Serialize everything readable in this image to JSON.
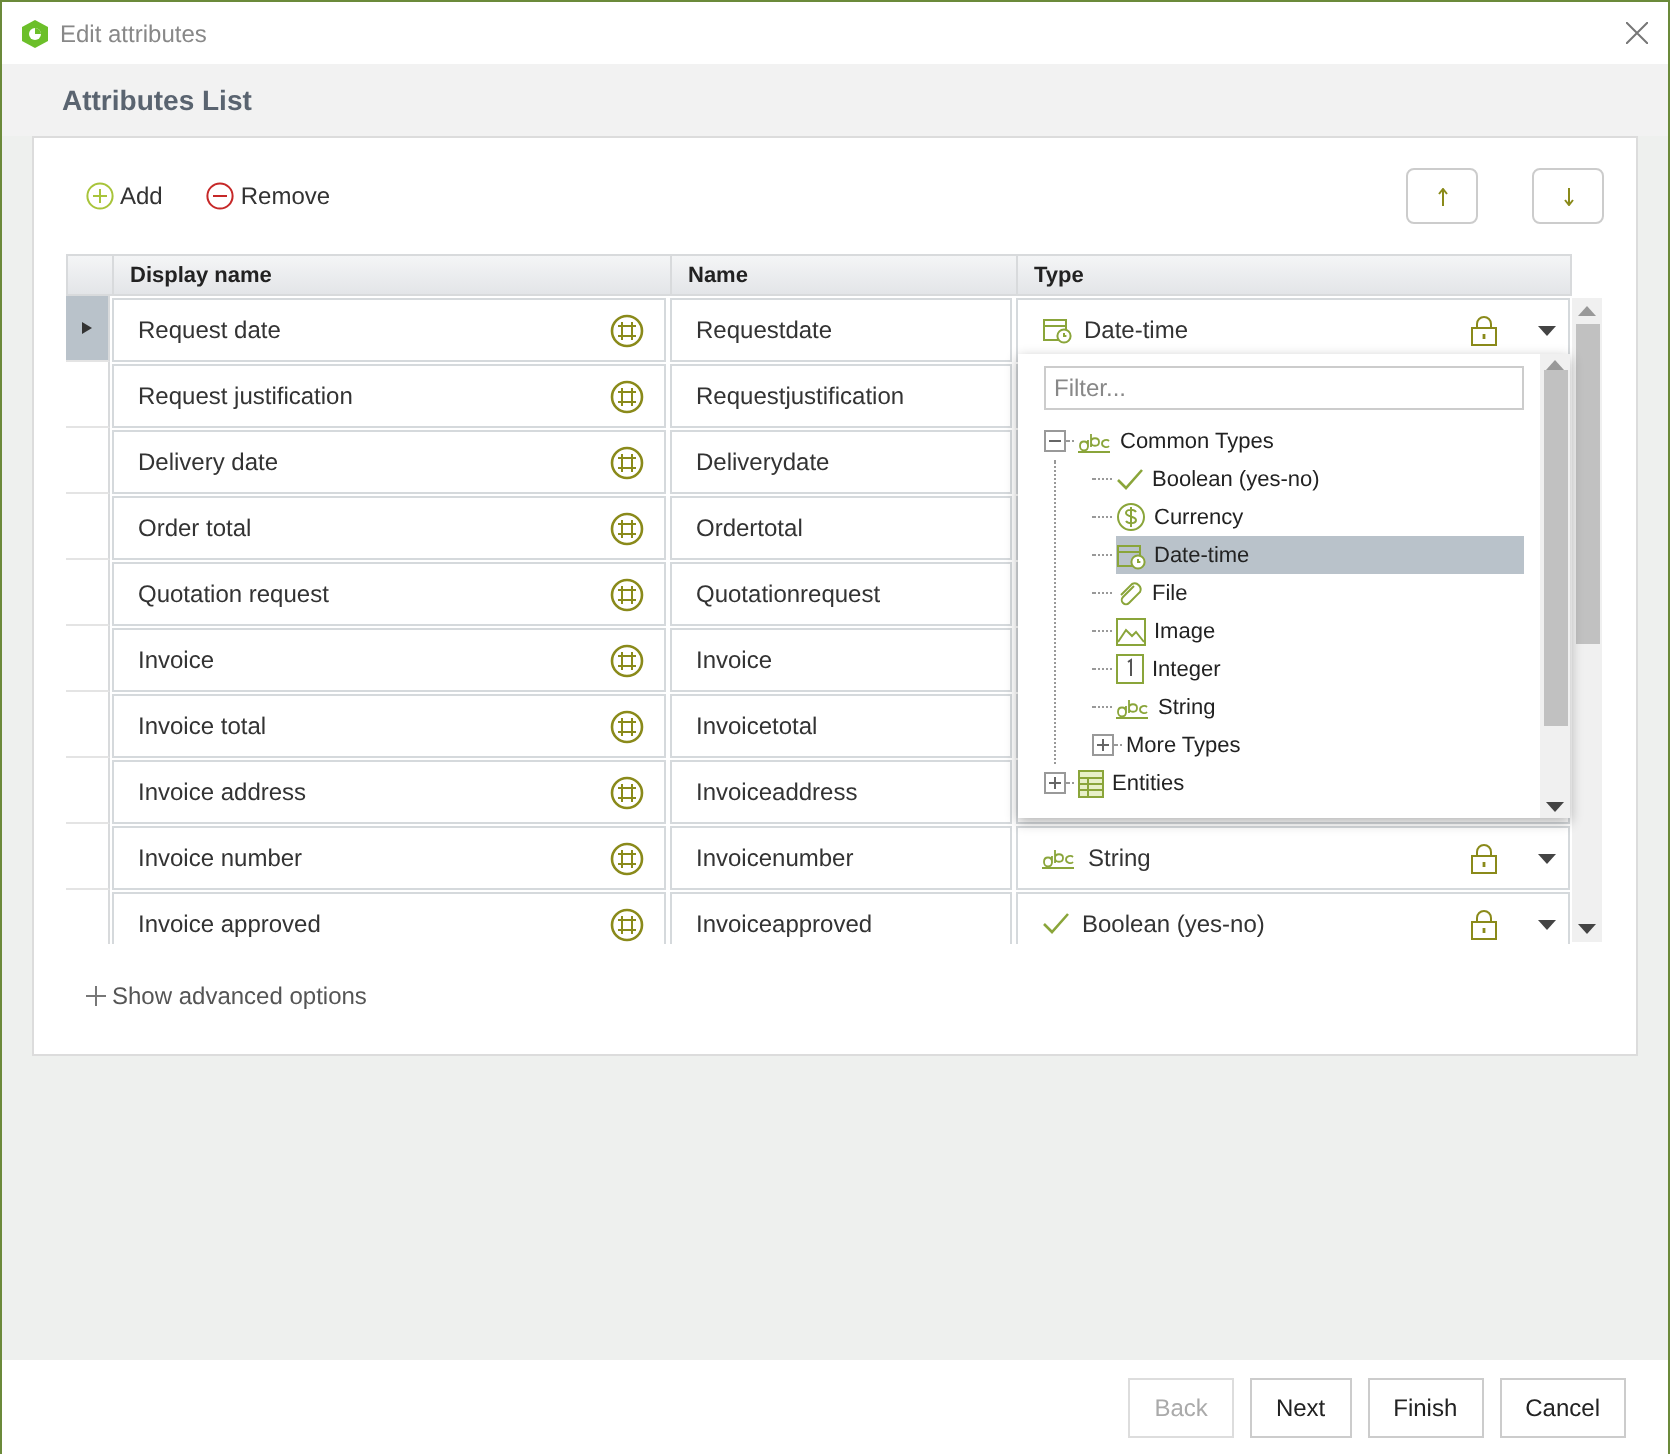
{
  "window": {
    "title": "Edit attributes"
  },
  "header": {
    "title": "Attributes List"
  },
  "toolbar": {
    "add": "Add",
    "remove": "Remove"
  },
  "table": {
    "columns": [
      "Display name",
      "Name",
      "Type"
    ],
    "rows": [
      {
        "display_name": "Request date",
        "name": "Requestdate",
        "selected": true,
        "type": {
          "label": "Date-time",
          "kind": "datetime"
        }
      },
      {
        "display_name": "Request justification",
        "name": "Requestjustification",
        "selected": false
      },
      {
        "display_name": "Delivery date",
        "name": "Deliverydate",
        "selected": false
      },
      {
        "display_name": "Order total",
        "name": "Ordertotal",
        "selected": false
      },
      {
        "display_name": "Quotation request",
        "name": "Quotationrequest",
        "selected": false
      },
      {
        "display_name": "Invoice",
        "name": "Invoice",
        "selected": false
      },
      {
        "display_name": "Invoice total",
        "name": "Invoicetotal",
        "selected": false
      },
      {
        "display_name": "Invoice address",
        "name": "Invoiceaddress",
        "selected": false
      },
      {
        "display_name": "Invoice number",
        "name": "Invoicenumber",
        "selected": false,
        "type": {
          "label": "String",
          "kind": "string"
        }
      },
      {
        "display_name": "Invoice approved",
        "name": "Invoiceapproved",
        "selected": false,
        "type": {
          "label": "Boolean (yes-no)",
          "kind": "boolean"
        }
      }
    ]
  },
  "type_dropdown": {
    "filter_placeholder": "Filter...",
    "tree": [
      {
        "label": "Common Types",
        "kind": "string",
        "expanded": true,
        "children": [
          {
            "label": "Boolean (yes-no)",
            "kind": "boolean",
            "selected": false
          },
          {
            "label": "Currency",
            "kind": "currency",
            "selected": false
          },
          {
            "label": "Date-time",
            "kind": "datetime",
            "selected": true
          },
          {
            "label": "File",
            "kind": "file",
            "selected": false
          },
          {
            "label": "Image",
            "kind": "image",
            "selected": false
          },
          {
            "label": "Integer",
            "kind": "integer",
            "selected": false
          },
          {
            "label": "String",
            "kind": "string",
            "selected": false
          },
          {
            "label": "More Types",
            "expanded": false
          }
        ]
      },
      {
        "label": "Entities",
        "kind": "entities",
        "expanded": false
      }
    ]
  },
  "advanced": "Show advanced options",
  "footer": {
    "buttons": [
      {
        "label": "Back",
        "disabled": true
      },
      {
        "label": "Next",
        "disabled": false
      },
      {
        "label": "Finish",
        "disabled": false
      },
      {
        "label": "Cancel",
        "disabled": false
      }
    ]
  }
}
